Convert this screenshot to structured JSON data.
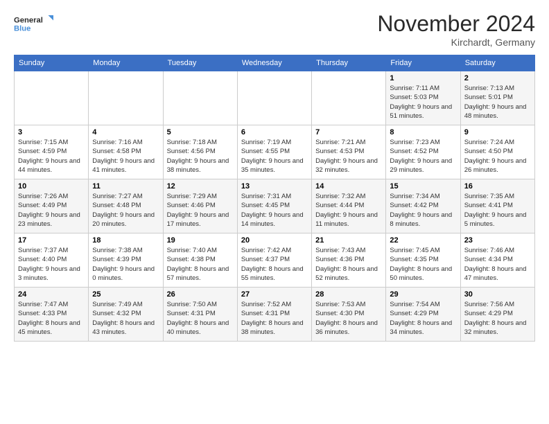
{
  "logo": {
    "line1": "General",
    "line2": "Blue"
  },
  "title": "November 2024",
  "location": "Kirchardt, Germany",
  "days_header": [
    "Sunday",
    "Monday",
    "Tuesday",
    "Wednesday",
    "Thursday",
    "Friday",
    "Saturday"
  ],
  "weeks": [
    [
      {
        "day": "",
        "info": ""
      },
      {
        "day": "",
        "info": ""
      },
      {
        "day": "",
        "info": ""
      },
      {
        "day": "",
        "info": ""
      },
      {
        "day": "",
        "info": ""
      },
      {
        "day": "1",
        "info": "Sunrise: 7:11 AM\nSunset: 5:03 PM\nDaylight: 9 hours and 51 minutes."
      },
      {
        "day": "2",
        "info": "Sunrise: 7:13 AM\nSunset: 5:01 PM\nDaylight: 9 hours and 48 minutes."
      }
    ],
    [
      {
        "day": "3",
        "info": "Sunrise: 7:15 AM\nSunset: 4:59 PM\nDaylight: 9 hours and 44 minutes."
      },
      {
        "day": "4",
        "info": "Sunrise: 7:16 AM\nSunset: 4:58 PM\nDaylight: 9 hours and 41 minutes."
      },
      {
        "day": "5",
        "info": "Sunrise: 7:18 AM\nSunset: 4:56 PM\nDaylight: 9 hours and 38 minutes."
      },
      {
        "day": "6",
        "info": "Sunrise: 7:19 AM\nSunset: 4:55 PM\nDaylight: 9 hours and 35 minutes."
      },
      {
        "day": "7",
        "info": "Sunrise: 7:21 AM\nSunset: 4:53 PM\nDaylight: 9 hours and 32 minutes."
      },
      {
        "day": "8",
        "info": "Sunrise: 7:23 AM\nSunset: 4:52 PM\nDaylight: 9 hours and 29 minutes."
      },
      {
        "day": "9",
        "info": "Sunrise: 7:24 AM\nSunset: 4:50 PM\nDaylight: 9 hours and 26 minutes."
      }
    ],
    [
      {
        "day": "10",
        "info": "Sunrise: 7:26 AM\nSunset: 4:49 PM\nDaylight: 9 hours and 23 minutes."
      },
      {
        "day": "11",
        "info": "Sunrise: 7:27 AM\nSunset: 4:48 PM\nDaylight: 9 hours and 20 minutes."
      },
      {
        "day": "12",
        "info": "Sunrise: 7:29 AM\nSunset: 4:46 PM\nDaylight: 9 hours and 17 minutes."
      },
      {
        "day": "13",
        "info": "Sunrise: 7:31 AM\nSunset: 4:45 PM\nDaylight: 9 hours and 14 minutes."
      },
      {
        "day": "14",
        "info": "Sunrise: 7:32 AM\nSunset: 4:44 PM\nDaylight: 9 hours and 11 minutes."
      },
      {
        "day": "15",
        "info": "Sunrise: 7:34 AM\nSunset: 4:42 PM\nDaylight: 9 hours and 8 minutes."
      },
      {
        "day": "16",
        "info": "Sunrise: 7:35 AM\nSunset: 4:41 PM\nDaylight: 9 hours and 5 minutes."
      }
    ],
    [
      {
        "day": "17",
        "info": "Sunrise: 7:37 AM\nSunset: 4:40 PM\nDaylight: 9 hours and 3 minutes."
      },
      {
        "day": "18",
        "info": "Sunrise: 7:38 AM\nSunset: 4:39 PM\nDaylight: 9 hours and 0 minutes."
      },
      {
        "day": "19",
        "info": "Sunrise: 7:40 AM\nSunset: 4:38 PM\nDaylight: 8 hours and 57 minutes."
      },
      {
        "day": "20",
        "info": "Sunrise: 7:42 AM\nSunset: 4:37 PM\nDaylight: 8 hours and 55 minutes."
      },
      {
        "day": "21",
        "info": "Sunrise: 7:43 AM\nSunset: 4:36 PM\nDaylight: 8 hours and 52 minutes."
      },
      {
        "day": "22",
        "info": "Sunrise: 7:45 AM\nSunset: 4:35 PM\nDaylight: 8 hours and 50 minutes."
      },
      {
        "day": "23",
        "info": "Sunrise: 7:46 AM\nSunset: 4:34 PM\nDaylight: 8 hours and 47 minutes."
      }
    ],
    [
      {
        "day": "24",
        "info": "Sunrise: 7:47 AM\nSunset: 4:33 PM\nDaylight: 8 hours and 45 minutes."
      },
      {
        "day": "25",
        "info": "Sunrise: 7:49 AM\nSunset: 4:32 PM\nDaylight: 8 hours and 43 minutes."
      },
      {
        "day": "26",
        "info": "Sunrise: 7:50 AM\nSunset: 4:31 PM\nDaylight: 8 hours and 40 minutes."
      },
      {
        "day": "27",
        "info": "Sunrise: 7:52 AM\nSunset: 4:31 PM\nDaylight: 8 hours and 38 minutes."
      },
      {
        "day": "28",
        "info": "Sunrise: 7:53 AM\nSunset: 4:30 PM\nDaylight: 8 hours and 36 minutes."
      },
      {
        "day": "29",
        "info": "Sunrise: 7:54 AM\nSunset: 4:29 PM\nDaylight: 8 hours and 34 minutes."
      },
      {
        "day": "30",
        "info": "Sunrise: 7:56 AM\nSunset: 4:29 PM\nDaylight: 8 hours and 32 minutes."
      }
    ]
  ]
}
